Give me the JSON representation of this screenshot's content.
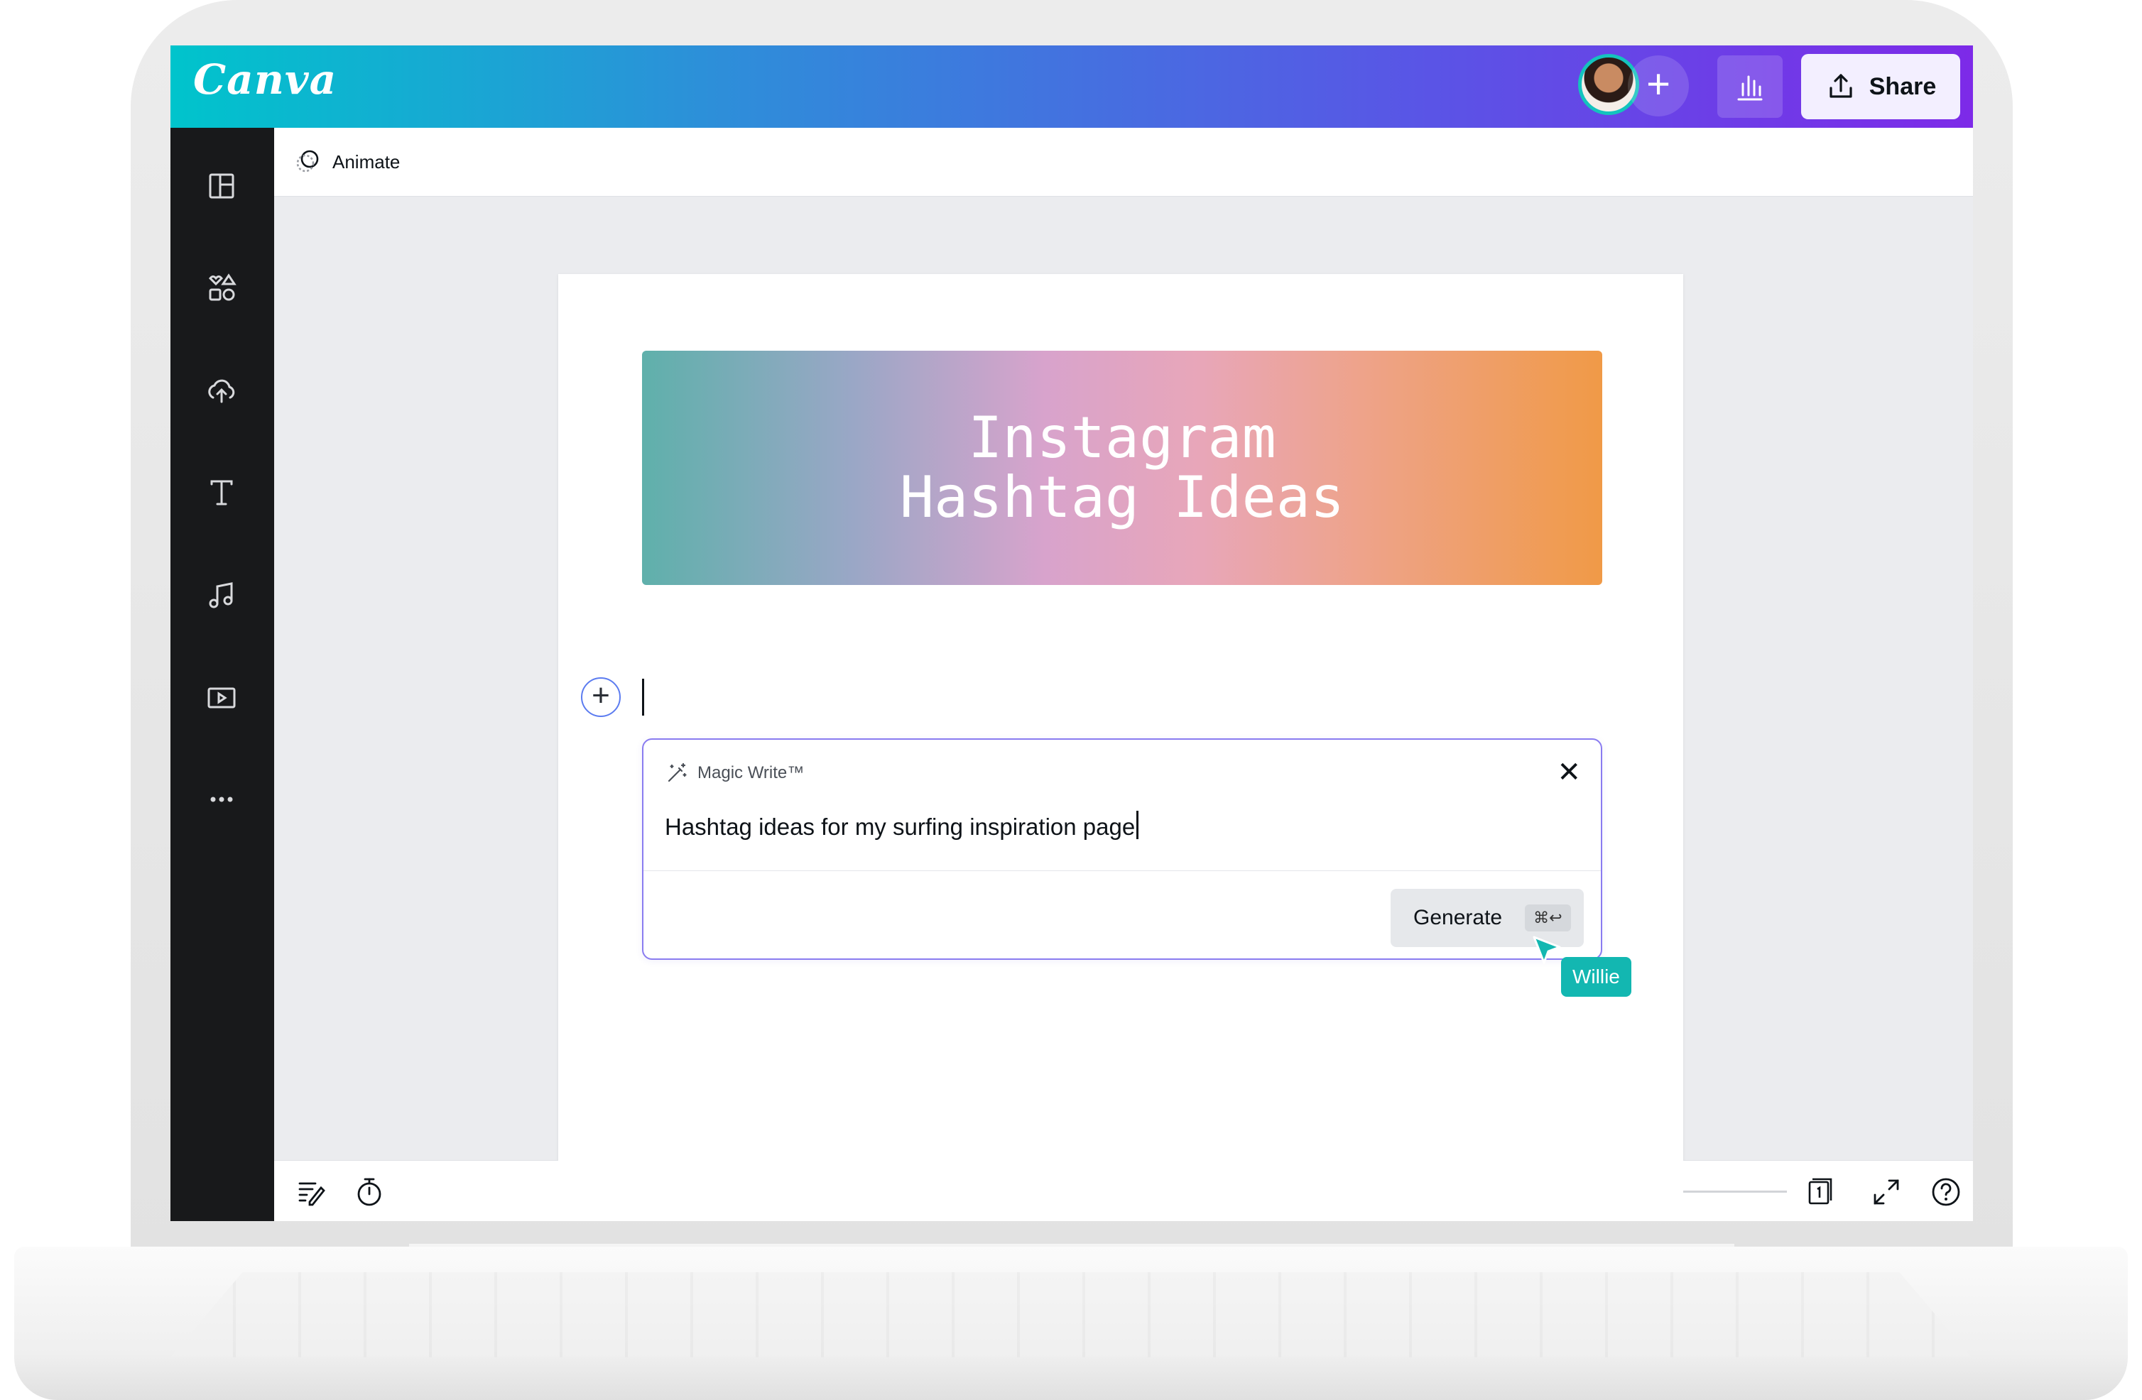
{
  "app": {
    "logo": "Canva"
  },
  "topbar": {
    "share_label": "Share",
    "add_icon": "plus-icon",
    "stats_icon": "bar-chart-icon",
    "share_icon": "upload-icon"
  },
  "rail": {
    "items": [
      {
        "icon": "layout-icon"
      },
      {
        "icon": "elements-icon"
      },
      {
        "icon": "upload-cloud-icon"
      },
      {
        "icon": "text-icon"
      },
      {
        "icon": "music-icon"
      },
      {
        "icon": "video-icon"
      },
      {
        "icon": "more-icon"
      }
    ]
  },
  "toolbar": {
    "animate_label": "Animate"
  },
  "canvas": {
    "banner_line1": "Instagram",
    "banner_line2": "Hashtag Ideas"
  },
  "magic_write": {
    "title": "Magic Write™",
    "input_value": "Hashtag ideas for my surfing inspiration page",
    "generate_label": "Generate",
    "shortcut": "⌘↩"
  },
  "collaborator": {
    "name": "Willie",
    "color": "#13b7b1"
  },
  "colors": {
    "brand_start": "#00c4cc",
    "brand_end": "#7d2ae8",
    "rail_bg": "#18191b"
  }
}
